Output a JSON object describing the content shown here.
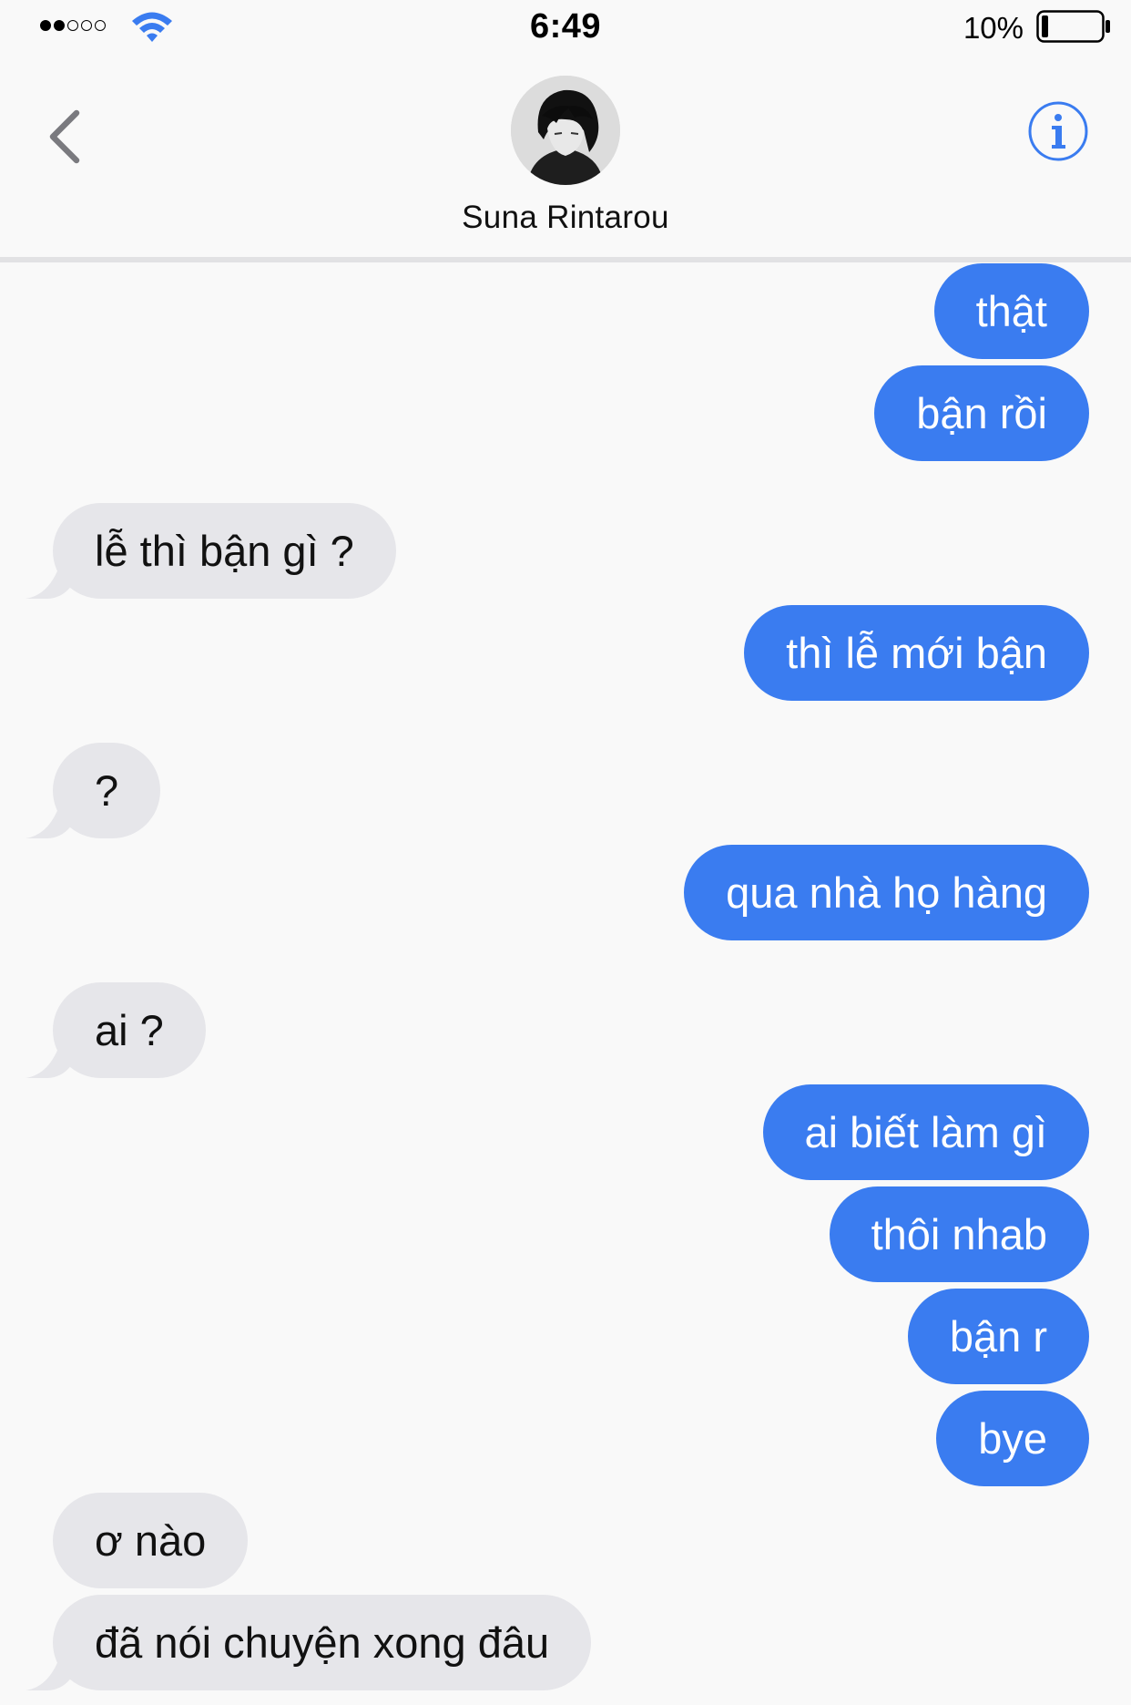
{
  "status_bar": {
    "time": "6:49",
    "battery_percent": "10%",
    "signal_filled_dots": 2,
    "signal_total_dots": 5
  },
  "header": {
    "contact_name": "Suna Rintarou",
    "back_icon": "chevron-left-icon",
    "info_icon": "info-icon"
  },
  "colors": {
    "sent_bubble": "#3a7cf0",
    "received_bubble": "#e6e6ea",
    "accent": "#3a7cf0"
  },
  "messages": [
    {
      "text": "thật",
      "from": "me"
    },
    {
      "text": "bận rồi",
      "from": "me"
    },
    {
      "text": "lễ thì bận gì ?",
      "from": "them"
    },
    {
      "text": "thì lễ mới bận",
      "from": "me"
    },
    {
      "text": "?",
      "from": "them"
    },
    {
      "text": "qua nhà họ hàng",
      "from": "me"
    },
    {
      "text": "ai ?",
      "from": "them"
    },
    {
      "text": "ai biết làm gì",
      "from": "me"
    },
    {
      "text": "thôi nhab",
      "from": "me"
    },
    {
      "text": "bận r",
      "from": "me"
    },
    {
      "text": "bye",
      "from": "me"
    },
    {
      "text": "ơ nào",
      "from": "them"
    },
    {
      "text": "đã nói chuyện xong đâu",
      "from": "them"
    }
  ]
}
